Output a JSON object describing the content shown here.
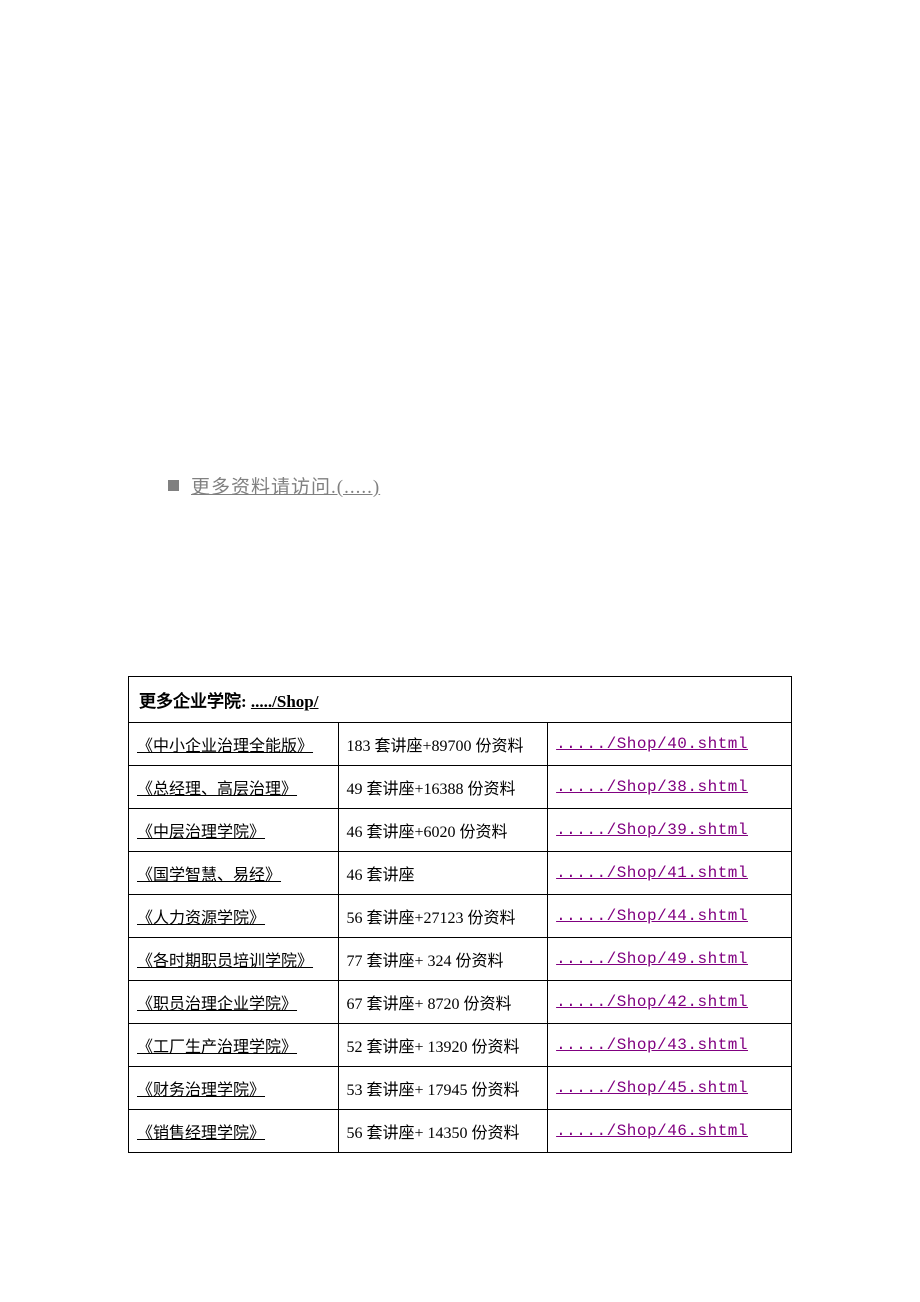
{
  "header": {
    "visit_text": "更多资料请访问.(.....)"
  },
  "table": {
    "title_label": "更多企业学院:",
    "title_url": "...../Shop/",
    "rows": [
      {
        "name": "《中小企业治理全能版》",
        "desc": "183 套讲座+89700 份资料",
        "url": "...../Shop/40.shtml"
      },
      {
        "name": "《总经理、高层治理》",
        "desc": "49 套讲座+16388 份资料",
        "url": "...../Shop/38.shtml"
      },
      {
        "name": "《中层治理学院》",
        "desc": "46 套讲座+6020 份资料",
        "url": "...../Shop/39.shtml"
      },
      {
        "name": "《国学智慧、易经》",
        "desc": "46 套讲座",
        "url": "...../Shop/41.shtml"
      },
      {
        "name": "《人力资源学院》",
        "desc": "56 套讲座+27123 份资料",
        "url": "...../Shop/44.shtml"
      },
      {
        "name": "《各时期职员培训学院》",
        "desc": "77 套讲座+ 324 份资料",
        "url": "...../Shop/49.shtml"
      },
      {
        "name": "《职员治理企业学院》",
        "desc": "67 套讲座+ 8720 份资料",
        "url": "...../Shop/42.shtml"
      },
      {
        "name": "《工厂生产治理学院》",
        "desc": "52 套讲座+ 13920 份资料",
        "url": "...../Shop/43.shtml"
      },
      {
        "name": "《财务治理学院》",
        "desc": "53 套讲座+ 17945 份资料",
        "url": "...../Shop/45.shtml"
      },
      {
        "name": "《销售经理学院》",
        "desc": "56 套讲座+ 14350 份资料",
        "url": "...../Shop/46.shtml"
      }
    ]
  }
}
